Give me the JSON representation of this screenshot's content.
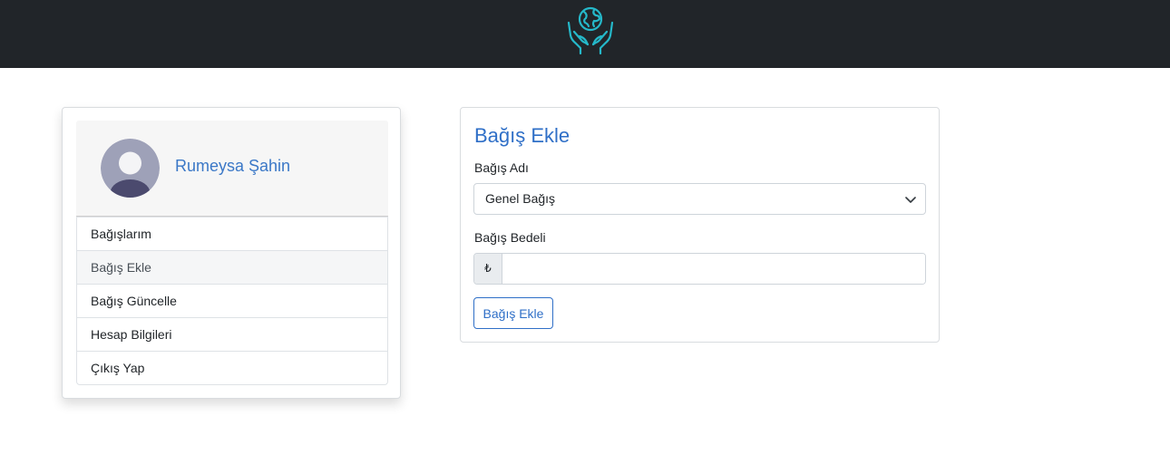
{
  "header": {
    "logo_icon": "globe-in-hands-icon",
    "logo_color": "#25b8c9",
    "background": "#212529"
  },
  "profile": {
    "name": "Rumeysa Şahin",
    "avatar_icon": "user-avatar-icon"
  },
  "sidebar": {
    "items": [
      {
        "label": "Bağışlarım",
        "active": false
      },
      {
        "label": "Bağış Ekle",
        "active": true
      },
      {
        "label": "Bağış Güncelle",
        "active": false
      },
      {
        "label": "Hesap Bilgileri",
        "active": false
      },
      {
        "label": "Çıkış Yap",
        "active": false
      }
    ]
  },
  "form": {
    "title": "Bağış Ekle",
    "donation_name_label": "Bağış Adı",
    "donation_name_selected": "Genel Bağış",
    "donation_amount_label": "Bağış Bedeli",
    "currency_symbol": "₺",
    "amount_value": "",
    "submit_label": "Bağış Ekle"
  },
  "colors": {
    "accent": "#2f6fc7",
    "navbar": "#212529"
  }
}
